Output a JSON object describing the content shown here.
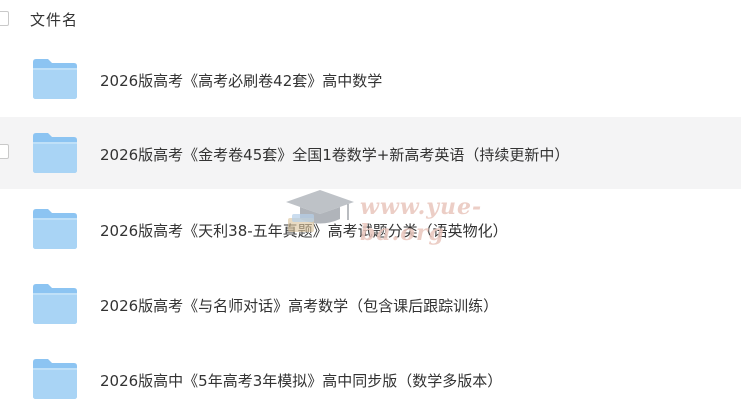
{
  "header": {
    "column_label": "文件名"
  },
  "files": [
    {
      "name": "2026版高考《高考必刷卷42套》高中数学",
      "type": "folder"
    },
    {
      "name": "2026版高考《金考卷45套》全国1卷数学+新高考英语（持续更新中）",
      "type": "folder"
    },
    {
      "name": "2026版高考《天利38-五年真题》高考试题分类（语英物化）",
      "type": "folder"
    },
    {
      "name": "2026版高考《与名师对话》高考数学（包含课后跟踪训练）",
      "type": "folder"
    },
    {
      "name": "2026版高中《5年高考3年模拟》高中同步版（数学多版本）",
      "type": "folder"
    }
  ],
  "watermark": {
    "text": "www.yue-ba.org",
    "icon": "graduation-cap-icon"
  },
  "colors": {
    "folder_light": "#a9d4f5",
    "folder_dark": "#7dbdf0",
    "row_highlight": "#f4f4f5",
    "watermark": "#e9c6bd"
  }
}
